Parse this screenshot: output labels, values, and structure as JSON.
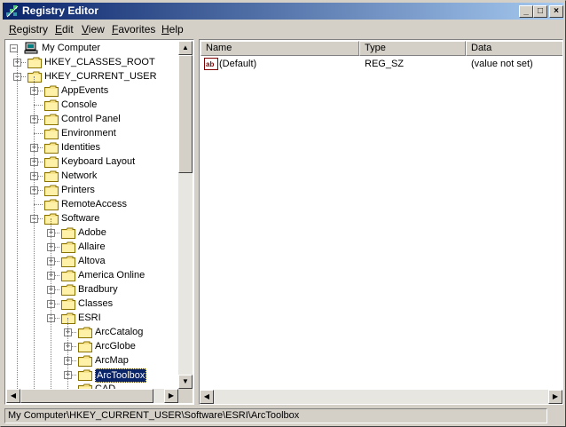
{
  "window": {
    "title": "Registry Editor"
  },
  "titlebar": {
    "minimize": "_",
    "maximize": "□",
    "close": "×"
  },
  "menu": [
    {
      "label": "Registry",
      "accel": "R",
      "rest": "egistry"
    },
    {
      "label": "Edit",
      "accel": "E",
      "rest": "dit"
    },
    {
      "label": "View",
      "accel": "V",
      "rest": "iew"
    },
    {
      "label": "Favorites",
      "accel": "F",
      "rest": "avorites"
    },
    {
      "label": "Help",
      "accel": "H",
      "rest": "elp"
    }
  ],
  "tree": {
    "root": "My Computer",
    "nodes": [
      {
        "label": "HKEY_CLASSES_ROOT",
        "depth": 1,
        "expander": "+"
      },
      {
        "label": "HKEY_CURRENT_USER",
        "depth": 1,
        "expander": "-"
      },
      {
        "label": "AppEvents",
        "depth": 2,
        "expander": "+"
      },
      {
        "label": "Console",
        "depth": 2,
        "expander": ""
      },
      {
        "label": "Control Panel",
        "depth": 2,
        "expander": "+"
      },
      {
        "label": "Environment",
        "depth": 2,
        "expander": ""
      },
      {
        "label": "Identities",
        "depth": 2,
        "expander": "+"
      },
      {
        "label": "Keyboard Layout",
        "depth": 2,
        "expander": "+"
      },
      {
        "label": "Network",
        "depth": 2,
        "expander": "+"
      },
      {
        "label": "Printers",
        "depth": 2,
        "expander": "+"
      },
      {
        "label": "RemoteAccess",
        "depth": 2,
        "expander": ""
      },
      {
        "label": "Software",
        "depth": 2,
        "expander": "-"
      },
      {
        "label": "Adobe",
        "depth": 3,
        "expander": "+"
      },
      {
        "label": "Allaire",
        "depth": 3,
        "expander": "+"
      },
      {
        "label": "Altova",
        "depth": 3,
        "expander": "+"
      },
      {
        "label": "America Online",
        "depth": 3,
        "expander": "+"
      },
      {
        "label": "Bradbury",
        "depth": 3,
        "expander": "+"
      },
      {
        "label": "Classes",
        "depth": 3,
        "expander": "+"
      },
      {
        "label": "ESRI",
        "depth": 3,
        "expander": "-"
      },
      {
        "label": "ArcCatalog",
        "depth": 4,
        "expander": "+"
      },
      {
        "label": "ArcGlobe",
        "depth": 4,
        "expander": "+"
      },
      {
        "label": "ArcMap",
        "depth": 4,
        "expander": "+"
      },
      {
        "label": "ArcToolbox",
        "depth": 4,
        "expander": "+",
        "selected": true
      },
      {
        "label": "CAD",
        "depth": 4,
        "expander": ""
      }
    ]
  },
  "list": {
    "columns": [
      "Name",
      "Type",
      "Data"
    ],
    "rows": [
      {
        "name": "(Default)",
        "type": "REG_SZ",
        "data": "(value not set)",
        "icon": "string-value-icon"
      }
    ]
  },
  "statusbar": {
    "path": "My Computer\\HKEY_CURRENT_USER\\Software\\ESRI\\ArcToolbox"
  }
}
